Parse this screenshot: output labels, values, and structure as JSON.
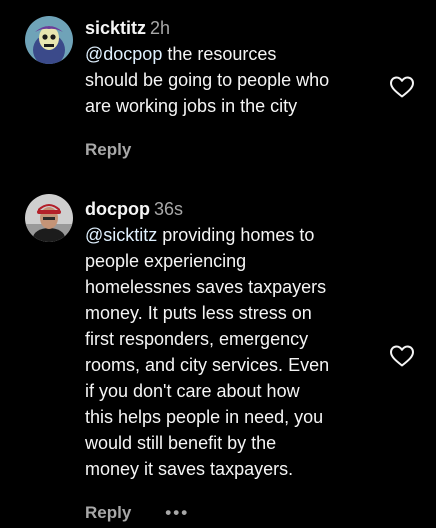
{
  "comments": [
    {
      "username": "sicktitz",
      "time": "2h",
      "mention": "@docpop",
      "text_line1": " the resources",
      "text_line2": "should be going to people who",
      "text_line3": "are working jobs in the city",
      "reply_label": "Reply",
      "avatar_icon": "skeletor-avatar-icon",
      "like_icon": "heart-outline-icon"
    },
    {
      "username": "docpop",
      "time": "36s",
      "mention": "@sicktitz",
      "text_line1": " providing homes to",
      "lines": [
        "people experiencing",
        "homelessnes saves taxpayers",
        "money. It puts less stress on",
        "first responders, emergency",
        "rooms, and city services. Even",
        "if you don't care about how",
        "this helps people in need, you",
        "would still benefit by the",
        "money it saves taxpayers."
      ],
      "reply_label": "Reply",
      "more_label": "•••",
      "avatar_icon": "person-photo-avatar-icon",
      "like_icon": "heart-outline-icon"
    }
  ],
  "colors": {
    "background": "#000000",
    "text": "#f5f5f5",
    "secondary": "#a8a8a8",
    "mention": "#e0f1ff"
  }
}
